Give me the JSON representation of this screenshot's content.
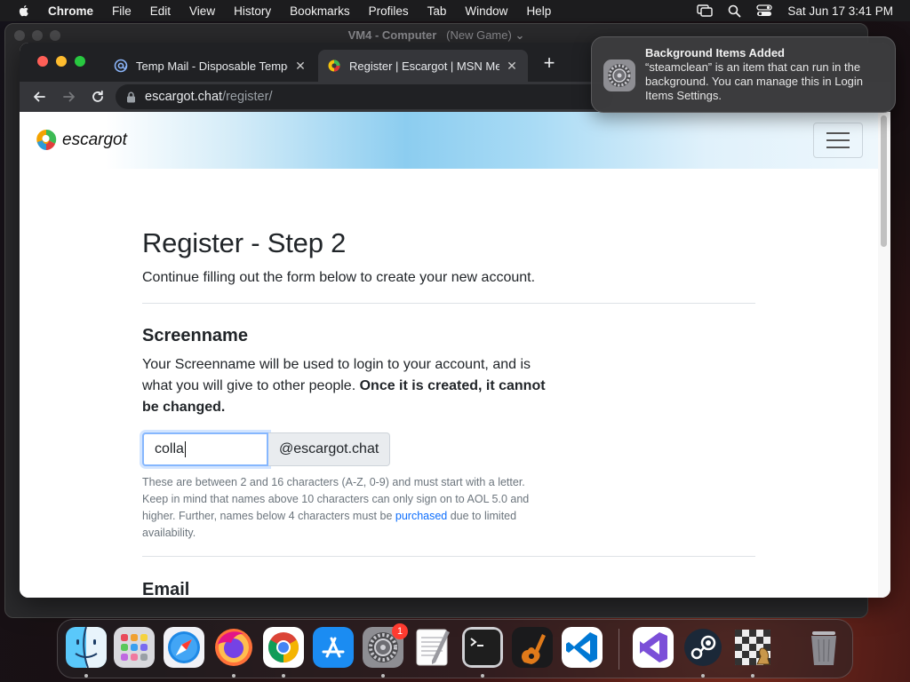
{
  "menubar": {
    "app_name": "Chrome",
    "items": [
      "File",
      "Edit",
      "View",
      "History",
      "Bookmarks",
      "Profiles",
      "Tab",
      "Window",
      "Help"
    ],
    "clock": "Sat Jun 17  3:41 PM"
  },
  "vm_window": {
    "title": "VM4 - Computer",
    "subtitle": "(New Game)"
  },
  "browser": {
    "tabs": [
      {
        "title": "Temp Mail - Disposable Tempor",
        "active": false
      },
      {
        "title": "Register | Escargot | MSN Mess",
        "active": true
      }
    ],
    "url_host": "escargot.chat",
    "url_path": "/register/"
  },
  "page": {
    "logo_text": "escargot",
    "heading": "Register - Step 2",
    "lead": "Continue filling out the form below to create your new account.",
    "screenname": {
      "title": "Screenname",
      "desc_plain": "Your Screenname will be used to login to your account, and is what you will give to other people. ",
      "desc_bold": "Once it is created, it cannot be changed.",
      "input_value": "colla",
      "addon": "@escargot.chat",
      "help_text": "These are between 2 and 16 characters (A-Z, 0-9) and must start with a letter. Keep in mind that names above 10 characters can only sign on to AOL 5.0 and higher. Further, names below 4 characters must be ",
      "help_link": "purchased",
      "help_tail": " due to limited availability."
    },
    "email_title": "Email"
  },
  "notification": {
    "title": "Background Items Added",
    "body": "“steamclean” is an item that can run in the background. You can manage this in Login Items Settings."
  },
  "dock": {
    "apps": [
      {
        "name": "Finder",
        "icon": "finder-icon",
        "running": true
      },
      {
        "name": "Launchpad",
        "icon": "launchpad-icon",
        "running": false
      },
      {
        "name": "Safari",
        "icon": "safari-icon",
        "running": false
      },
      {
        "name": "Firefox",
        "icon": "firefox-icon",
        "running": true
      },
      {
        "name": "Chrome",
        "icon": "chrome-icon",
        "running": true
      },
      {
        "name": "App Store",
        "icon": "app-store-icon",
        "running": false
      },
      {
        "name": "System Settings",
        "icon": "system-settings-icon",
        "running": true,
        "badge": "1"
      },
      {
        "name": "TextEdit",
        "icon": "textedit-icon",
        "running": false
      },
      {
        "name": "Terminal",
        "icon": "terminal-icon",
        "running": true
      },
      {
        "name": "GarageBand",
        "icon": "garageband-icon",
        "running": false
      },
      {
        "name": "VS Code",
        "icon": "vscode-icon",
        "running": false
      },
      {
        "name": "Visual Studio",
        "icon": "visual-studio-icon",
        "running": false
      },
      {
        "name": "Steam",
        "icon": "steam-icon",
        "running": true
      },
      {
        "name": "Chess",
        "icon": "chess-icon",
        "running": true
      },
      {
        "name": "Trash",
        "icon": "trash-icon",
        "running": false
      }
    ]
  }
}
